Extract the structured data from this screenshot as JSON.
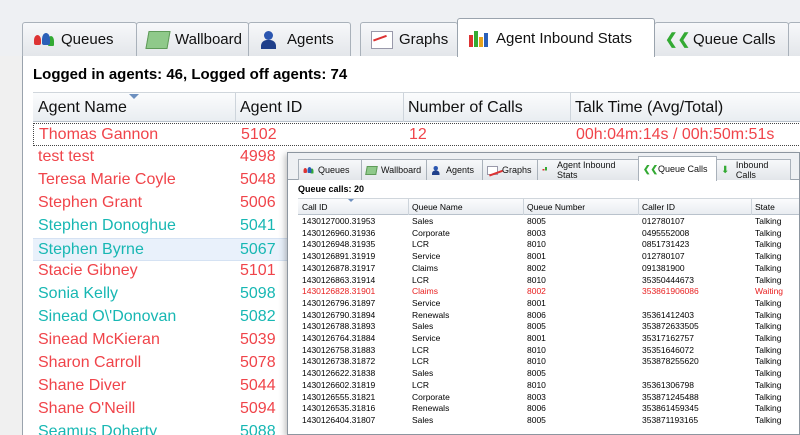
{
  "main": {
    "tabs": [
      {
        "label": "Queues",
        "icon": "queues-icon"
      },
      {
        "label": "Wallboard",
        "icon": "wallboard-icon"
      },
      {
        "label": "Agents",
        "icon": "agents-icon"
      },
      {
        "label": "Graphs",
        "icon": "graphs-icon"
      },
      {
        "label": "Agent Inbound Stats",
        "icon": "inbound-stats-icon"
      },
      {
        "label": "Queue Calls",
        "icon": "queue-calls-icon"
      }
    ],
    "active_tab": "Agent Inbound Stats",
    "summary": "Logged in agents: 46, Logged off agents: 74",
    "columns": [
      "Agent Name",
      "Agent ID",
      "Number of Calls",
      "Talk Time (Avg/Total)"
    ],
    "rows": [
      {
        "name": "Thomas  Gannon",
        "id": "5102",
        "calls": "12",
        "talk": "00h:04m:14s / 00h:50m:51s",
        "status": "logged-off"
      },
      {
        "name": "test test",
        "id": "4998",
        "calls": "",
        "talk": "",
        "status": "logged-off"
      },
      {
        "name": "Teresa Marie Coyle",
        "id": "5048",
        "calls": "",
        "talk": "",
        "status": "logged-off"
      },
      {
        "name": "Stephen Grant",
        "id": "5006",
        "calls": "",
        "talk": "",
        "status": "logged-off"
      },
      {
        "name": "Stephen Donoghue",
        "id": "5041",
        "calls": "",
        "talk": "",
        "status": "logged-in"
      },
      {
        "name": "Stephen Byrne",
        "id": "5067",
        "calls": "",
        "talk": "",
        "status": "logged-in"
      },
      {
        "name": "Stacie  Gibney",
        "id": "5101",
        "calls": "",
        "talk": "",
        "status": "logged-off"
      },
      {
        "name": "Sonia  Kelly",
        "id": "5098",
        "calls": "",
        "talk": "",
        "status": "logged-in"
      },
      {
        "name": "Sinead O\\'Donovan",
        "id": "5082",
        "calls": "",
        "talk": "",
        "status": "logged-in"
      },
      {
        "name": "Sinead McKieran",
        "id": "5039",
        "calls": "",
        "talk": "",
        "status": "logged-off"
      },
      {
        "name": "Sharon  Carroll",
        "id": "5078",
        "calls": "",
        "talk": "",
        "status": "logged-off"
      },
      {
        "name": "Shane Diver",
        "id": "5044",
        "calls": "",
        "talk": "",
        "status": "logged-off"
      },
      {
        "name": "Shane  O'Neill",
        "id": "5094",
        "calls": "",
        "talk": "",
        "status": "logged-off"
      },
      {
        "name": "Seamus Doherty",
        "id": "5088",
        "calls": "",
        "talk": "",
        "status": "logged-in"
      }
    ]
  },
  "overlay": {
    "tabs": [
      {
        "label": "Queues",
        "icon": "queues-icon"
      },
      {
        "label": "Wallboard",
        "icon": "wallboard-icon"
      },
      {
        "label": "Agents",
        "icon": "agents-icon"
      },
      {
        "label": "Graphs",
        "icon": "graphs-icon"
      },
      {
        "label": "Agent Inbound Stats",
        "icon": "inbound-stats-icon"
      },
      {
        "label": "Queue Calls",
        "icon": "queue-calls-icon"
      },
      {
        "label": "Inbound Calls",
        "icon": "inbound-calls-icon"
      }
    ],
    "active_tab": "Queue Calls",
    "summary": "Queue calls: 20",
    "columns": [
      "Call ID",
      "Queue Name",
      "Queue Number",
      "Caller ID",
      "State"
    ],
    "rows": [
      {
        "call_id": "1430127000.31953",
        "queue": "Sales",
        "number": "8005",
        "caller": "012780107",
        "state": "Talking"
      },
      {
        "call_id": "1430126960.31936",
        "queue": "Corporate",
        "number": "8003",
        "caller": "0495552008",
        "state": "Talking"
      },
      {
        "call_id": "1430126948.31935",
        "queue": "LCR",
        "number": "8010",
        "caller": "0851731423",
        "state": "Talking"
      },
      {
        "call_id": "1430126891.31919",
        "queue": "Service",
        "number": "8001",
        "caller": "012780107",
        "state": "Talking"
      },
      {
        "call_id": "1430126878.31917",
        "queue": "Claims",
        "number": "8002",
        "caller": "091381900",
        "state": "Talking"
      },
      {
        "call_id": "1430126863.31914",
        "queue": "LCR",
        "number": "8010",
        "caller": "35350444673",
        "state": "Talking"
      },
      {
        "call_id": "1430126828.31901",
        "queue": "Claims",
        "number": "8002",
        "caller": "353861906086",
        "state": "Waiting"
      },
      {
        "call_id": "1430126796.31897",
        "queue": "Service",
        "number": "8001",
        "caller": "",
        "state": "Talking"
      },
      {
        "call_id": "1430126790.31894",
        "queue": "Renewals",
        "number": "8006",
        "caller": "35361412403",
        "state": "Talking"
      },
      {
        "call_id": "1430126788.31893",
        "queue": "Sales",
        "number": "8005",
        "caller": "353872633505",
        "state": "Talking"
      },
      {
        "call_id": "1430126764.31884",
        "queue": "Service",
        "number": "8001",
        "caller": "35317162757",
        "state": "Talking"
      },
      {
        "call_id": "1430126758.31883",
        "queue": "LCR",
        "number": "8010",
        "caller": "35351646072",
        "state": "Talking"
      },
      {
        "call_id": "1430126738.31872",
        "queue": "LCR",
        "number": "8010",
        "caller": "353878255620",
        "state": "Talking"
      },
      {
        "call_id": "1430126622.31838",
        "queue": "Sales",
        "number": "8005",
        "caller": "",
        "state": "Talking"
      },
      {
        "call_id": "1430126602.31819",
        "queue": "LCR",
        "number": "8010",
        "caller": "35361306798",
        "state": "Talking"
      },
      {
        "call_id": "1430126555.31821",
        "queue": "Corporate",
        "number": "8003",
        "caller": "353871245488",
        "state": "Talking"
      },
      {
        "call_id": "1430126535.31816",
        "queue": "Renewals",
        "number": "8006",
        "caller": "353861459345",
        "state": "Talking"
      },
      {
        "call_id": "1430126404.31807",
        "queue": "Sales",
        "number": "8005",
        "caller": "353871193165",
        "state": "Talking"
      }
    ]
  },
  "colors": {
    "logged_in": "#17b7b3",
    "logged_off": "#f0444a",
    "waiting": "#e81e1e"
  }
}
